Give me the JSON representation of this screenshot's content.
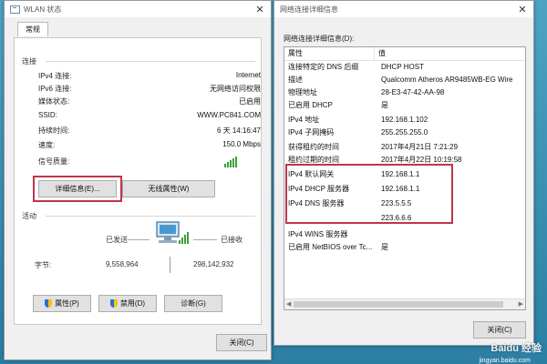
{
  "wlan": {
    "title": "WLAN 状态",
    "tab": "常规",
    "connection_section": "连接",
    "rows": [
      {
        "label": "IPv4 连接:",
        "value": "Internet"
      },
      {
        "label": "IPv6 连接:",
        "value": "无网络访问权限"
      },
      {
        "label": "媒体状态:",
        "value": "已启用"
      },
      {
        "label": "SSID:",
        "value": "WWW.PC841.COM"
      },
      {
        "label": "持续时间:",
        "value": "6 天 14:16:47"
      },
      {
        "label": "速度:",
        "value": "150.0 Mbps"
      }
    ],
    "signal_label": "信号质量:",
    "details_button": "详细信息(E)...",
    "wireless_button": "无线属性(W)",
    "activity_section": "活动",
    "sent_label": "已发送",
    "received_label": "已接收",
    "bytes_label": "字节:",
    "bytes_sent": "9,558,964",
    "bytes_received": "298,142,932",
    "properties_button": "属性(P)",
    "disable_button": "禁用(D)",
    "diagnose_button": "诊断(G)",
    "close_button": "关闭(C)"
  },
  "details": {
    "title": "网络连接详细信息",
    "caption": "网络连接详细信息(D):",
    "columns": [
      "属性",
      "值"
    ],
    "rows": [
      {
        "prop": "连接特定的 DNS 后缀",
        "value": "DHCP HOST"
      },
      {
        "prop": "描述",
        "value": "Qualcomm Atheros AR9485WB-EG Wire"
      },
      {
        "prop": "物理地址",
        "value": "28-E3-47-42-AA-98"
      },
      {
        "prop": "已启用 DHCP",
        "value": "是"
      },
      {
        "prop": "IPv4 地址",
        "value": "192.168.1.102"
      },
      {
        "prop": "IPv4 子网掩码",
        "value": "255.255.255.0"
      },
      {
        "prop": "获得租约的时间",
        "value": "2017年4月21日 7:21:29"
      },
      {
        "prop": "租约过期的时间",
        "value": "2017年4月22日 10:19:58"
      },
      {
        "prop": "IPv4 默认网关",
        "value": "192.168.1.1"
      },
      {
        "prop": "IPv4 DHCP 服务器",
        "value": "192.168.1.1"
      },
      {
        "prop": "IPv4 DNS 服务器",
        "value": "223.5.5.5"
      },
      {
        "prop": "",
        "value": "223.6.6.6"
      },
      {
        "prop": "IPv4 WINS 服务器",
        "value": ""
      },
      {
        "prop": "已启用 NetBIOS over Tc...",
        "value": "是"
      }
    ],
    "close_button": "关闭(C)"
  },
  "watermark": {
    "brand": "Baidu 经验",
    "url": "jingyan.baidu.com"
  },
  "colors": {
    "highlight_border": "#c0354a",
    "signal": "#3aa03a"
  }
}
